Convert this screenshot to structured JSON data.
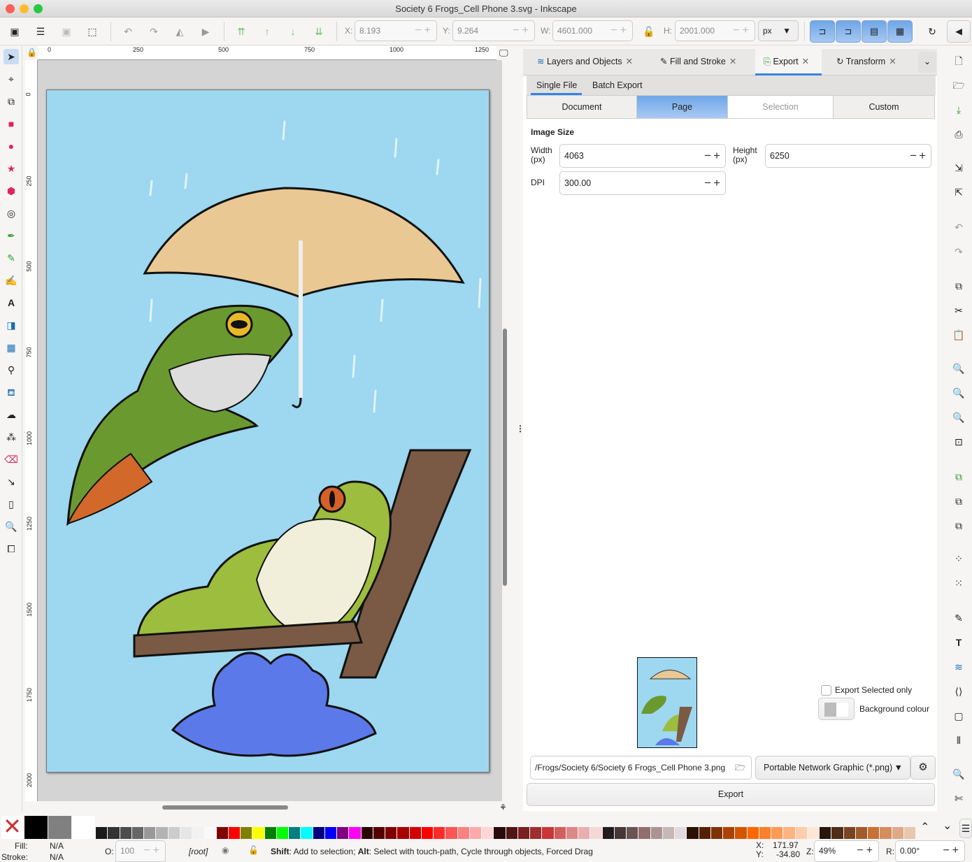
{
  "window": {
    "title": "Society 6 Frogs_Cell Phone 3.svg - Inkscape"
  },
  "toolbar": {
    "x_label": "X:",
    "x_value": "8.193",
    "y_label": "Y:",
    "y_value": "9.264",
    "w_label": "W:",
    "w_value": "4601.000",
    "h_label": "H:",
    "h_value": "2001.000",
    "unit": "px"
  },
  "ruler": {
    "top": [
      "0",
      "250",
      "500",
      "750",
      "1000",
      "1250"
    ],
    "left": [
      "0",
      "250",
      "500",
      "750",
      "1000",
      "1250",
      "1500",
      "1750",
      "2000"
    ]
  },
  "dock": {
    "tabs": [
      {
        "label": "Layers and Objects"
      },
      {
        "label": "Fill and Stroke"
      },
      {
        "label": "Export"
      },
      {
        "label": "Transform"
      }
    ],
    "subtabs": [
      "Single File",
      "Batch Export"
    ],
    "areas": [
      "Document",
      "Page",
      "Selection",
      "Custom"
    ],
    "image_size_title": "Image Size",
    "width_label": "Width\n(px)",
    "width_value": "4063",
    "height_label": "Height\n(px)",
    "height_value": "6250",
    "dpi_label": "DPI",
    "dpi_value": "300.00",
    "export_selected_only": "Export Selected only",
    "background_colour": "Background colour",
    "filename": "/Frogs/Society 6/Society 6 Frogs_Cell Phone 3.png",
    "format": "Portable Network Graphic (*.png)",
    "export_button": "Export"
  },
  "palette": [
    "#1a1a1a",
    "#333333",
    "#4d4d4d",
    "#666666",
    "#999999",
    "#b3b3b3",
    "#cccccc",
    "#e6e6e6",
    "#f2f2f2",
    "#f9f9f9",
    "#800000",
    "#ff0000",
    "#808000",
    "#ffff00",
    "#008000",
    "#00ff00",
    "#008080",
    "#00ffff",
    "#000080",
    "#0000ff",
    "#800080",
    "#ff00ff",
    "#2b0000",
    "#550000",
    "#800000",
    "#aa0000",
    "#d40000",
    "#ff0000",
    "#ff2a2a",
    "#ff5555",
    "#ff8080",
    "#ffaaaa",
    "#ffd5d5",
    "#280b0b",
    "#501616",
    "#782121",
    "#a02c2c",
    "#c83737",
    "#d35f5f",
    "#de8787",
    "#e9afaf",
    "#f4d7d7",
    "#241c1c",
    "#483737",
    "#6c5353",
    "#916f6f",
    "#ac9393",
    "#c8b7b7",
    "#e3dbdb",
    "#2b1100",
    "#552200",
    "#803300",
    "#aa4400",
    "#d45500",
    "#ff6600",
    "#ff7f2a",
    "#ff9955",
    "#ffb380",
    "#ffccaa",
    "#ffe6d5",
    "#28170b",
    "#502d16",
    "#784421",
    "#a05a2c",
    "#c87137",
    "#d38d5f",
    "#deaa87",
    "#e9c6af"
  ],
  "status": {
    "fill_label": "Fill:",
    "fill_value": "N/A",
    "stroke_label": "Stroke:",
    "stroke_value": "N/A",
    "opacity_label": "O:",
    "opacity_value": "100",
    "layer": "[root]",
    "hint_shift": "Shift",
    "hint_1": ": Add to selection; ",
    "hint_alt": "Alt",
    "hint_2": ": Select with touch-path, Cycle through objects, Forced Drag",
    "cursor_x_label": "X:",
    "cursor_x": "171.97",
    "cursor_y_label": "Y:",
    "cursor_y": "-34.80",
    "zoom_label": "Z:",
    "zoom": "49%",
    "rotation_label": "R:",
    "rotation": "0.00°"
  }
}
